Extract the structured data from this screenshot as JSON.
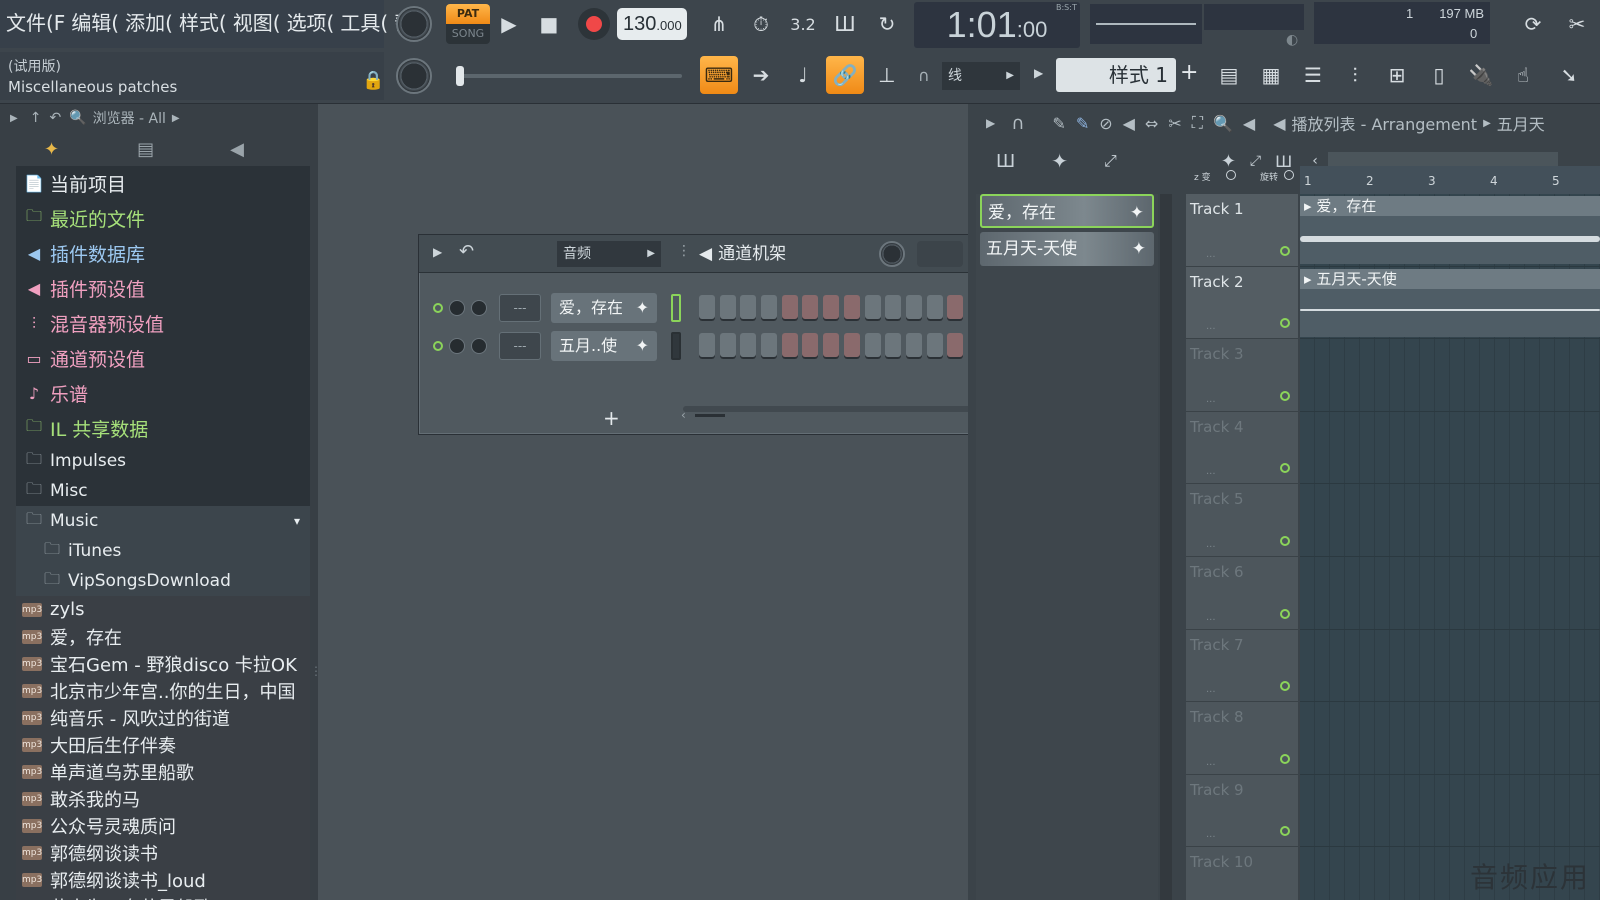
{
  "menu": [
    "文件(F",
    "编辑(",
    "添加(",
    "样式(",
    "视图(",
    "选项(",
    "工具(",
    "帮"
  ],
  "hint": {
    "line1": "(试用版)",
    "line2": "Miscellaneous patches"
  },
  "transport": {
    "pat": "PAT",
    "song": "SONG",
    "tempo_main": "130",
    "tempo_frac": ".000"
  },
  "time": {
    "main": "1:01",
    "sub": ":00",
    "label": "B:S:T"
  },
  "cpu": {
    "count": "1",
    "mem": "197 MB",
    "poly": "0"
  },
  "snap_label": "线",
  "pattern_label": "样式 1",
  "browser": {
    "path": "浏览器 - All",
    "folders": [
      {
        "icon": "📄",
        "label": "当前项目",
        "color": "#e8edf0"
      },
      {
        "icon": "🗀",
        "label": "最近的文件",
        "color": "#a6e07a"
      },
      {
        "icon": "◀",
        "label": "插件数据库",
        "color": "#9cc8f0"
      },
      {
        "icon": "◀",
        "label": "插件预设值",
        "color": "#f0a0c0"
      },
      {
        "icon": "⫶",
        "label": "混音器预设值",
        "color": "#f0a0c0"
      },
      {
        "icon": "▭",
        "label": "通道预设值",
        "color": "#f0a0c0"
      },
      {
        "icon": "♪",
        "label": "乐谱",
        "color": "#f0a0c0"
      },
      {
        "icon": "🗀",
        "label": "IL 共享数据",
        "color": "#a6e07a"
      }
    ],
    "plain": [
      {
        "label": "Impulses"
      },
      {
        "label": "Misc"
      },
      {
        "label": "Music"
      },
      {
        "label": "iTunes"
      },
      {
        "label": "VipSongsDownload"
      }
    ],
    "files": [
      "zyls",
      "爱，存在",
      "宝石Gem - 野狼disco 卡拉OK",
      "北京市少年宫..你的生日，中国",
      "纯音乐 - 风吹过的街道",
      "大田后生仔伴奏",
      "单声道乌苏里船歌",
      "敢杀我的马",
      "公众号灵魂质问",
      "郭德纲谈读书",
      "郭德纲谈读书_loud",
      "黄大为 - 乌苏里船歌"
    ],
    "mp3_badge": "mp3"
  },
  "rack": {
    "filter": "音频",
    "title": "通道机架",
    "channels": [
      {
        "name": "爱，存在",
        "mix": "---"
      },
      {
        "name": "五月..使",
        "mix": "---"
      }
    ],
    "add": "+"
  },
  "playlist": {
    "title": "播放列表 - Arrangement",
    "crumb": "五月天",
    "clips": [
      "爱，存在",
      "五月天-天使"
    ],
    "tracks": [
      "Track 1",
      "Track 2",
      "Track 3",
      "Track 4",
      "Track 5",
      "Track 6",
      "Track 7",
      "Track 8",
      "Track 9",
      "Track 10"
    ],
    "ruler": [
      "1",
      "2",
      "3",
      "4",
      "5"
    ],
    "zoom_labels": [
      "z 变 ",
      "旋转 "
    ],
    "lane_clips": [
      "爱，存在",
      "五月天-天使"
    ]
  },
  "watermark": "音频应用"
}
